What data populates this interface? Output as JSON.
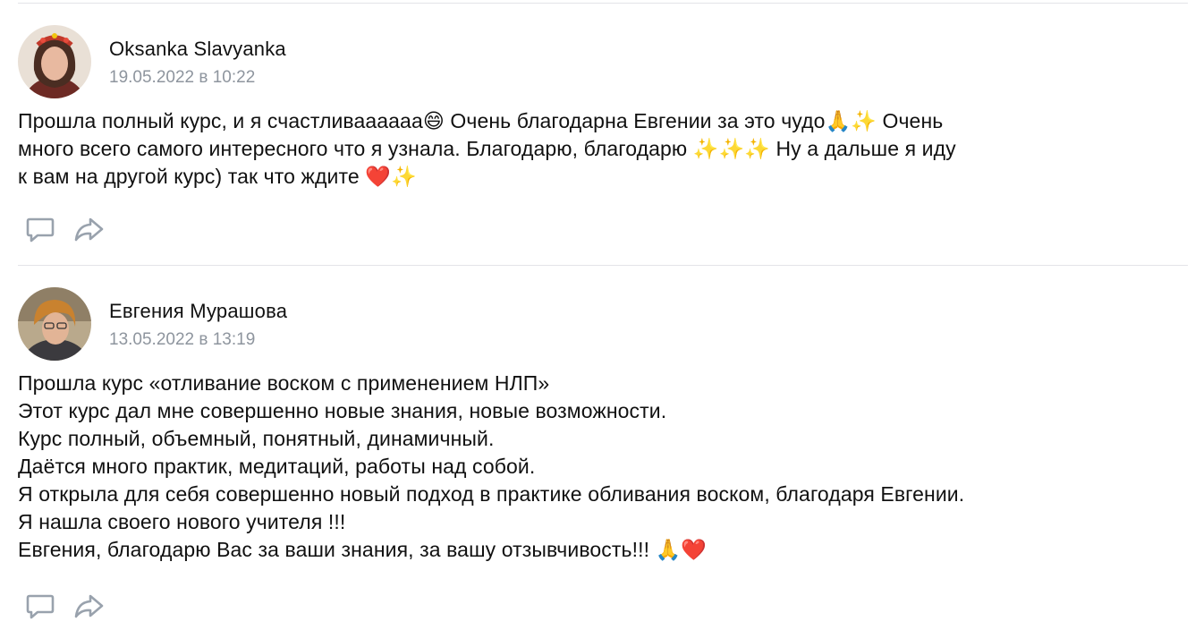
{
  "posts": [
    {
      "author": "Oksanka Slavyanka",
      "date": "19.05.2022 в 10:22",
      "text_lines": [
        "Прошла полный курс, и я счастливаааааа😄 Очень благодарна Евгении за это чудо🙏✨ Очень",
        "много всего самого интересного что я узнала. Благодарю, благодарю ✨✨✨ Ну а дальше я иду",
        "к вам на другой курс) так что ждите ❤️✨"
      ]
    },
    {
      "author": "Евгения Мурашова",
      "date": "13.05.2022 в 13:19",
      "text_lines": [
        "Прошла курс «отливание воском с применением НЛП»",
        "Этот курс дал мне совершенно новые знания, новые возможности.",
        "Курс полный, объемный, понятный, динамичный.",
        "Даётся много практик, медитаций, работы над собой.",
        "Я открыла для себя совершенно новый подход в практике обливания воском, благодаря Евгении.",
        "Я нашла своего нового учителя !!!",
        "Евгения, благодарю Вас за ваши знания, за вашу отзывчивость!!! 🙏❤️"
      ]
    }
  ],
  "icons": {
    "comment": "comment-icon",
    "share": "share-icon"
  },
  "colors": {
    "icon": "#99a2ad",
    "date": "#8e959e",
    "divider": "#e3e4e8"
  }
}
